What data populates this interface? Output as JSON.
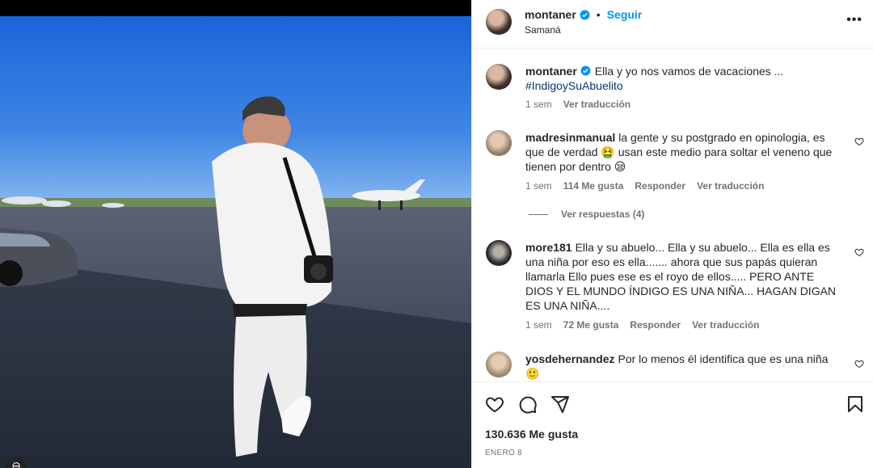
{
  "post": {
    "username": "montaner",
    "follow_label": "Seguir",
    "location": "Samaná",
    "more_icon": "more-options-icon"
  },
  "caption": {
    "username": "montaner",
    "text": "Ella y yo nos vamos de vacaciones ...",
    "hashtag": "#IndigoySuAbuelito",
    "time": "1 sem",
    "translate": "Ver traducción"
  },
  "comments": [
    {
      "username": "madresinmanual",
      "text": "la gente y su postgrado en opinologia, es que de verdad 🤮 usan este medio para soltar el veneno que tienen por dentro 😪",
      "time": "1 sem",
      "likes": "114 Me gusta",
      "reply": "Responder",
      "translate": "Ver traducción",
      "replies_label": "Ver respuestas (4)"
    },
    {
      "username": "more181",
      "text": "Ella y su abuelo... Ella y su abuelo... Ella es ella es una niña por eso es ella....... ahora que sus papás quieran llamarla Ello pues ese es el royo de ellos..... PERO ANTE DIOS Y EL MUNDO ÍNDIGO ES UNA NIÑA... HAGAN DIGAN ES UNA NIÑA....",
      "time": "1 sem",
      "likes": "72 Me gusta",
      "reply": "Responder",
      "translate": "Ver traducción"
    },
    {
      "username": "yosdehernandez",
      "text": "Por lo menos él identifica que es una niña 🙂"
    }
  ],
  "actions": {
    "like_icon": "heart-icon",
    "comment_icon": "comment-icon",
    "share_icon": "share-icon",
    "save_icon": "bookmark-icon",
    "likes": "130.636 Me gusta",
    "date": "Enero 8"
  },
  "colors": {
    "link": "#0095f6",
    "hashtag": "#00376b",
    "secondary_text": "#737373"
  }
}
